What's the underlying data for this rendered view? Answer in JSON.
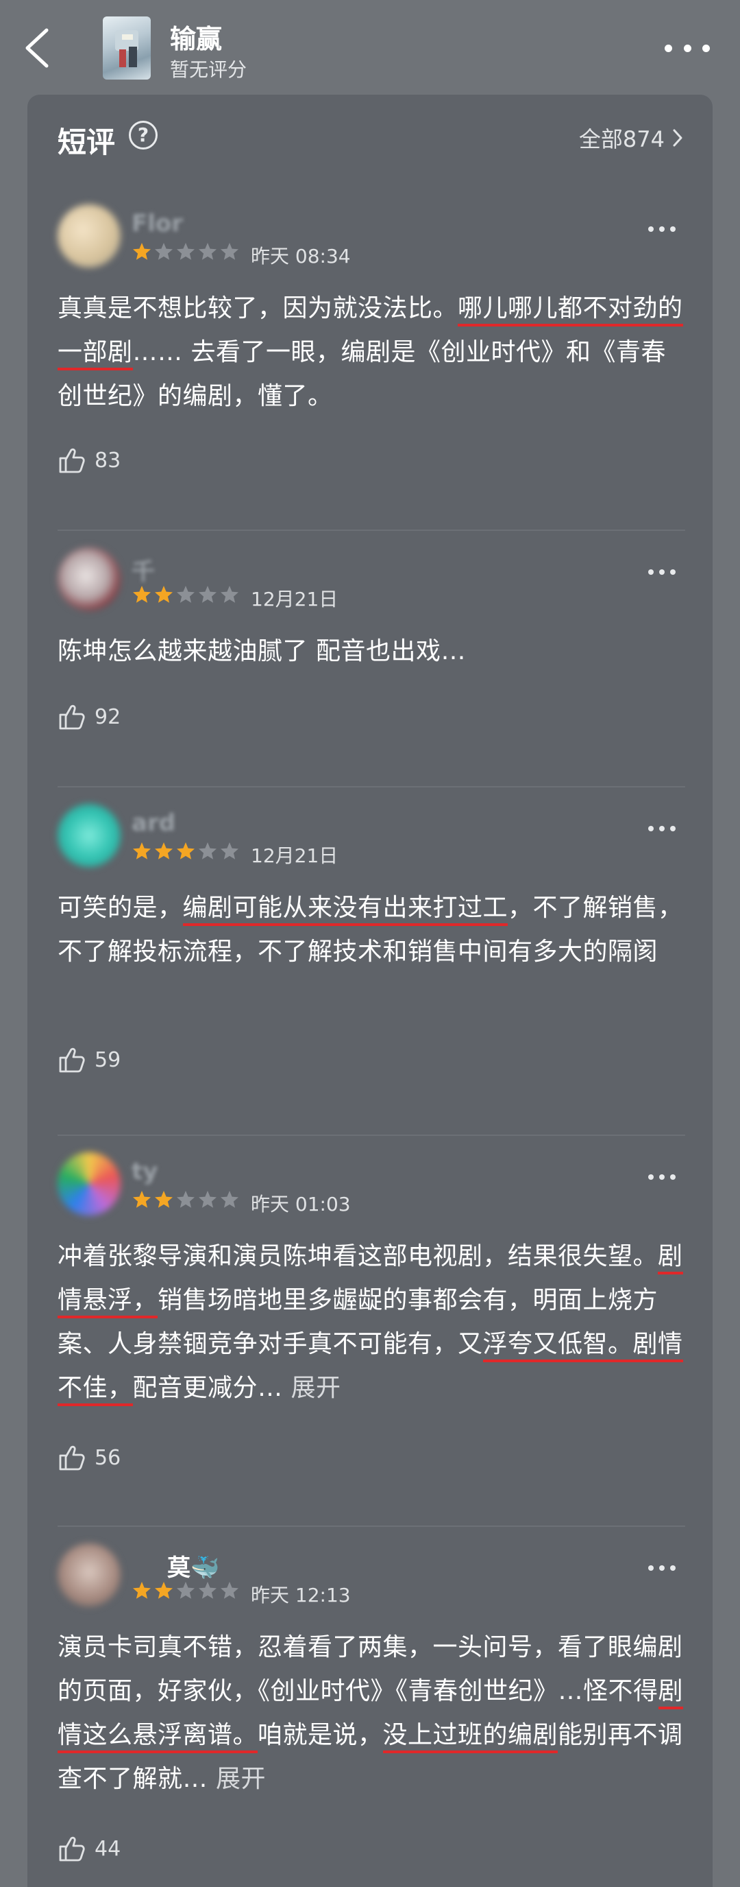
{
  "header": {
    "title": "输赢",
    "subtitle": "暂无评分"
  },
  "section": {
    "title": "短评",
    "all_link": "全部874"
  },
  "colors": {
    "star_filled": "#f5a623",
    "star_empty": "#8c9096",
    "underline": "#e0282a"
  },
  "reviews": [
    {
      "username": "Flor",
      "rating": 1,
      "time": "昨天 08:34",
      "text_parts": [
        "真真是不想比较了，因为就没法比。",
        "哪儿哪儿都不对劲的一部剧",
        "…… 去看了一眼，编剧是《创业时代》和《青春创世纪》的编剧，懂了。"
      ],
      "likes": "83"
    },
    {
      "username": "千",
      "rating": 2,
      "time": "12月21日",
      "text": "陈坤怎么越来越油腻了 配音也出戏…",
      "likes": "92"
    },
    {
      "username": "ard",
      "rating": 3,
      "time": "12月21日",
      "text_parts": [
        "可笑的是，",
        "编剧可能从来没有出来打过工",
        "，不了解销售，不了解投标流程，不了解技术和销售中间有多大的隔阂"
      ],
      "likes": "59"
    },
    {
      "username": "ty",
      "rating": 2,
      "time": "昨天 01:03",
      "text_parts": [
        "冲着张黎导演和演员陈坤看这部电视剧，结果很失望。",
        "剧情悬浮，",
        "销售场暗地里多龌龊的事都会有，明面上烧方案、人身禁锢竞争对手真不可能有，又",
        "浮夸又低智。剧情不佳，",
        "配音更减分…"
      ],
      "expand": "展开",
      "likes": "56"
    },
    {
      "username": "莫🐳",
      "rating": 2,
      "time": "昨天 12:13",
      "text_parts": [
        "演员卡司真不错，忍着看了两集，一头问号，看了眼编剧的页面，好家伙，《创业时代》《青春创世纪》…怪不得",
        "剧情这么悬浮离谱。",
        "咱就是说，",
        "没上过班的编剧",
        "能别再不调查不了解就…"
      ],
      "expand": "展开",
      "likes": "44"
    }
  ]
}
